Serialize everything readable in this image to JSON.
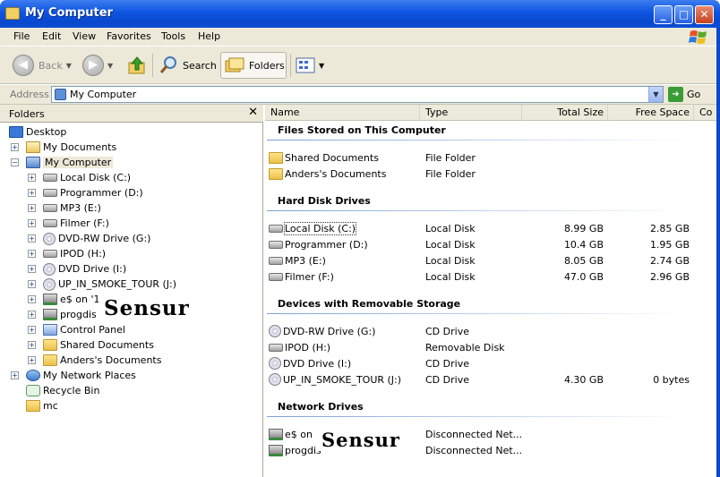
{
  "window": {
    "title": "My Computer",
    "minimize": "_",
    "maximize": "□",
    "close": "✕"
  },
  "menu": [
    "File",
    "Edit",
    "View",
    "Favorites",
    "Tools",
    "Help"
  ],
  "toolbar": {
    "back": "Back",
    "search": "Search",
    "folders": "Folders"
  },
  "address": {
    "label": "Address",
    "value": "My Computer",
    "go": "Go"
  },
  "folders_pane": {
    "title": "Folders",
    "close": "✕",
    "tree": [
      {
        "label": "Desktop",
        "icon": "desktop-icon"
      },
      {
        "label": "My Documents",
        "icon": "my-documents-icon"
      },
      {
        "label": "My Computer",
        "icon": "computer-icon"
      },
      {
        "label": "Local Disk (C:)",
        "icon": "drive-icon"
      },
      {
        "label": "Programmer (D:)",
        "icon": "drive-icon"
      },
      {
        "label": "MP3 (E:)",
        "icon": "drive-icon"
      },
      {
        "label": "Filmer (F:)",
        "icon": "drive-icon"
      },
      {
        "label": "DVD-RW Drive (G:)",
        "icon": "cd-icon"
      },
      {
        "label": "IPOD (H:)",
        "icon": "drive-icon"
      },
      {
        "label": "DVD Drive (I:)",
        "icon": "cd-icon"
      },
      {
        "label": "UP_IN_SMOKE_TOUR (J:)",
        "icon": "cd-icon"
      },
      {
        "label": "e$ on '1",
        "icon": "network-drive-icon"
      },
      {
        "label": "progdis",
        "icon": "network-drive-icon"
      },
      {
        "label": "Control Panel",
        "icon": "control-panel-icon"
      },
      {
        "label": "Shared Documents",
        "icon": "folder-icon"
      },
      {
        "label": "Anders's Documents",
        "icon": "folder-icon"
      },
      {
        "label": "My Network Places",
        "icon": "network-places-icon"
      },
      {
        "label": "Recycle Bin",
        "icon": "recycle-bin-icon"
      },
      {
        "label": "mc",
        "icon": "folder-icon"
      }
    ],
    "watermark": "Sensur"
  },
  "list": {
    "columns": [
      "Name",
      "Type",
      "Total Size",
      "Free Space",
      "Co"
    ],
    "groups": [
      {
        "title": "Files Stored on This Computer",
        "items": [
          {
            "name": "Shared Documents",
            "type": "File Folder",
            "total": "",
            "free": "",
            "icon": "folder-icon"
          },
          {
            "name": "Anders's Documents",
            "type": "File Folder",
            "total": "",
            "free": "",
            "icon": "folder-icon"
          }
        ]
      },
      {
        "title": "Hard Disk Drives",
        "items": [
          {
            "name": "Local Disk (C:)",
            "type": "Local Disk",
            "total": "8.99 GB",
            "free": "2.85 GB",
            "icon": "drive-icon"
          },
          {
            "name": "Programmer (D:)",
            "type": "Local Disk",
            "total": "10.4 GB",
            "free": "1.95 GB",
            "icon": "drive-icon"
          },
          {
            "name": "MP3 (E:)",
            "type": "Local Disk",
            "total": "8.05 GB",
            "free": "2.74 GB",
            "icon": "drive-icon"
          },
          {
            "name": "Filmer (F:)",
            "type": "Local Disk",
            "total": "47.0 GB",
            "free": "2.96 GB",
            "icon": "drive-icon"
          }
        ]
      },
      {
        "title": "Devices with Removable Storage",
        "items": [
          {
            "name": "DVD-RW Drive (G:)",
            "type": "CD Drive",
            "total": "",
            "free": "",
            "icon": "cd-icon"
          },
          {
            "name": "IPOD (H:)",
            "type": "Removable Disk",
            "total": "",
            "free": "",
            "icon": "drive-icon"
          },
          {
            "name": "DVD Drive (I:)",
            "type": "CD Drive",
            "total": "",
            "free": "",
            "icon": "cd-icon"
          },
          {
            "name": "UP_IN_SMOKE_TOUR (J:)",
            "type": "CD Drive",
            "total": "4.30 GB",
            "free": "0 bytes",
            "icon": "cd-icon"
          }
        ]
      },
      {
        "title": "Network Drives",
        "items": [
          {
            "name": "e$ on '1",
            "type": "Disconnected Net...",
            "total": "",
            "free": "",
            "icon": "network-drive-icon"
          },
          {
            "name": "progdis",
            "type": "Disconnected Net...",
            "total": "",
            "free": "",
            "icon": "network-drive-icon"
          }
        ]
      }
    ],
    "watermark": "Sensur"
  }
}
